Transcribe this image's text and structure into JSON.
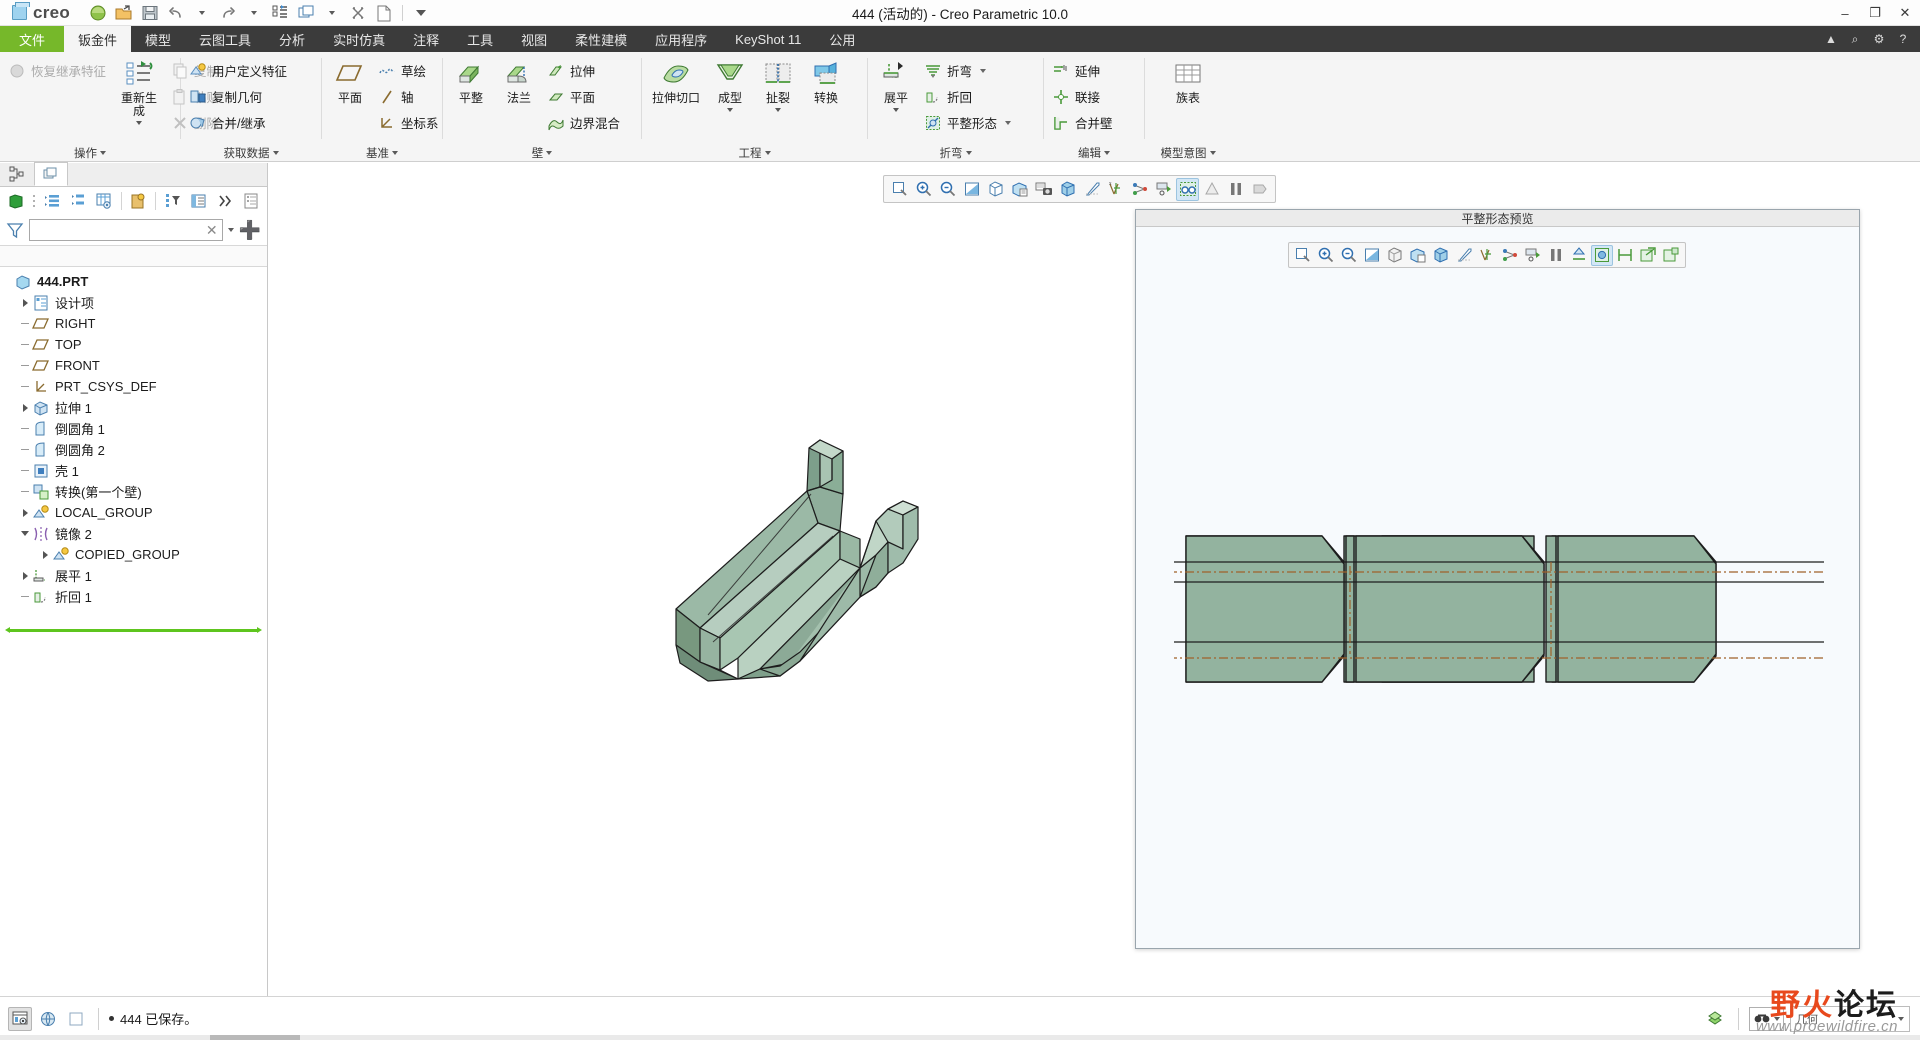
{
  "window": {
    "title": "444 (活动的) - Creo Parametric 10.0",
    "brand": "creo",
    "minimize": "–",
    "maximize": "❐",
    "close": "✕"
  },
  "quick_access": [
    {
      "name": "new-session-icon",
      "label": "新建会话"
    },
    {
      "name": "open-folder-icon",
      "label": "打开"
    },
    {
      "name": "save-icon",
      "label": "保存"
    },
    {
      "name": "undo-icon",
      "label": "撤消"
    },
    {
      "name": "undo-dropdown",
      "label": "撤消列表"
    },
    {
      "name": "redo-icon",
      "label": "重做"
    },
    {
      "name": "redo-dropdown",
      "label": "重做列表"
    },
    {
      "name": "regenerate-icon",
      "label": "重新生成"
    },
    {
      "name": "window-icon",
      "label": "窗口"
    },
    {
      "name": "window-dropdown",
      "label": "窗口列表"
    },
    {
      "name": "close-window-icon",
      "label": "关闭"
    },
    {
      "name": "new-doc-icon",
      "label": "新建"
    },
    {
      "name": "qat-customize",
      "label": "自定义快速访问工具栏"
    }
  ],
  "tabs": [
    {
      "label": "文件",
      "kind": "file"
    },
    {
      "label": "钣金件",
      "kind": "active"
    },
    {
      "label": "模型",
      "kind": "normal"
    },
    {
      "label": "云图工具",
      "kind": "normal"
    },
    {
      "label": "分析",
      "kind": "normal"
    },
    {
      "label": "实时仿真",
      "kind": "normal"
    },
    {
      "label": "注释",
      "kind": "normal"
    },
    {
      "label": "工具",
      "kind": "normal"
    },
    {
      "label": "视图",
      "kind": "normal"
    },
    {
      "label": "柔性建模",
      "kind": "normal"
    },
    {
      "label": "应用程序",
      "kind": "normal"
    },
    {
      "label": "KeyShot 11",
      "kind": "normal"
    },
    {
      "label": "公用",
      "kind": "normal"
    }
  ],
  "tab_right_icons": [
    {
      "name": "collapse-ribbon-icon",
      "glyph": "▲"
    },
    {
      "name": "search-icon",
      "glyph": "⌕"
    },
    {
      "name": "settings-icon",
      "glyph": "⚙"
    },
    {
      "name": "help-icon",
      "glyph": "?"
    }
  ],
  "ribbon": {
    "groups": [
      {
        "label": "操作",
        "items": [
          {
            "name": "restore-inherit-feature",
            "label": "恢复继承特征",
            "icon": "sphere-icon",
            "size": "small",
            "disabled": true
          },
          {
            "name": "regenerate",
            "label": "重新生成",
            "icon": "regenerate-icon",
            "size": "big",
            "dropdown": true
          },
          {
            "name": "copy",
            "label": "复制",
            "icon": "copy-icon",
            "size": "small",
            "disabled": true
          },
          {
            "name": "paste",
            "label": "粘贴",
            "icon": "paste-icon",
            "size": "small",
            "disabled": true,
            "dropdown": true
          },
          {
            "name": "delete",
            "label": "删除",
            "icon": "delete-icon",
            "size": "small",
            "disabled": true,
            "dropdown": true
          }
        ]
      },
      {
        "label": "获取数据",
        "items": [
          {
            "name": "user-defined-feature",
            "label": "用户定义特征",
            "icon": "udf-icon",
            "size": "small"
          },
          {
            "name": "copy-geometry",
            "label": "复制几何",
            "icon": "copy-geom-icon",
            "size": "small"
          },
          {
            "name": "merge-inherit",
            "label": "合并/继承",
            "icon": "merge-icon",
            "size": "small"
          }
        ]
      },
      {
        "label": "基准",
        "items": [
          {
            "name": "datum-plane",
            "label": "平面",
            "icon": "plane-icon",
            "size": "big"
          },
          {
            "name": "sketch",
            "label": "草绘",
            "icon": "sketch-icon",
            "size": "small"
          },
          {
            "name": "datum-axis",
            "label": "轴",
            "icon": "axis-icon",
            "size": "small"
          },
          {
            "name": "coordinate-system",
            "label": "坐标系",
            "icon": "csys-icon",
            "size": "small"
          }
        ]
      },
      {
        "label": "壁",
        "items": [
          {
            "name": "planar-wall",
            "label": "平整",
            "icon": "planar-wall-icon",
            "size": "big"
          },
          {
            "name": "flange-wall",
            "label": "法兰",
            "icon": "flange-icon",
            "size": "big"
          },
          {
            "name": "extrude",
            "label": "拉伸",
            "icon": "extrude-icon",
            "size": "small"
          },
          {
            "name": "flat-surface",
            "label": "平面",
            "icon": "flat-surface-icon",
            "size": "small"
          },
          {
            "name": "boundary-blend",
            "label": "边界混合",
            "icon": "boundary-blend-icon",
            "size": "small"
          }
        ]
      },
      {
        "label": "工程",
        "items": [
          {
            "name": "extruded-cut",
            "label": "拉伸切口",
            "icon": "extruded-cut-icon",
            "size": "big"
          },
          {
            "name": "form",
            "label": "成型",
            "icon": "form-icon",
            "size": "big",
            "dropdown": true
          },
          {
            "name": "rip",
            "label": "扯裂",
            "icon": "rip-icon",
            "size": "big",
            "dropdown": true
          },
          {
            "name": "convert",
            "label": "转换",
            "icon": "convert-icon",
            "size": "big"
          }
        ]
      },
      {
        "label": "折弯",
        "items": [
          {
            "name": "unbend",
            "label": "展平",
            "icon": "unbend-icon",
            "size": "big",
            "dropdown": true
          },
          {
            "name": "bend",
            "label": "折弯",
            "icon": "bend-icon",
            "size": "small",
            "dropdown": true
          },
          {
            "name": "bend-back",
            "label": "折回",
            "icon": "bend-back-icon",
            "size": "small"
          },
          {
            "name": "flat-state",
            "label": "平整形态",
            "icon": "flat-state-icon",
            "size": "small",
            "dropdown": true
          }
        ]
      },
      {
        "label": "编辑",
        "items": [
          {
            "name": "extend",
            "label": "延伸",
            "icon": "extend-icon",
            "size": "small"
          },
          {
            "name": "merge",
            "label": "联接",
            "icon": "join-icon",
            "size": "small"
          },
          {
            "name": "merge-walls",
            "label": "合并壁",
            "icon": "merge-walls-icon",
            "size": "small"
          }
        ]
      },
      {
        "label": "模型意图",
        "items": [
          {
            "name": "family-table",
            "label": "族表",
            "icon": "family-table-icon",
            "size": "big"
          }
        ]
      }
    ]
  },
  "navigator": {
    "tabs": [
      {
        "name": "model-tree-tab",
        "icon": "model-tree-icon"
      },
      {
        "name": "layer-tree-tab",
        "icon": "layers-icon"
      }
    ],
    "toolbar": [
      {
        "name": "show-display-icon",
        "glyph": "box"
      },
      {
        "name": "tree-columns-icon",
        "glyph": "list"
      },
      {
        "name": "tree-filters-icon",
        "glyph": "filters"
      },
      {
        "name": "tree-settings-icon",
        "glyph": "settings"
      },
      {
        "name": "search-model-icon",
        "glyph": "search"
      },
      {
        "name": "filter-icon",
        "glyph": "funnel"
      },
      {
        "name": "display-style-icon",
        "glyph": "display"
      },
      {
        "name": "more-icon",
        "glyph": "chevrons"
      },
      {
        "name": "detail-icon",
        "glyph": "detail"
      }
    ],
    "filter": {
      "value": "",
      "placeholder": ""
    },
    "tree": [
      {
        "label": "444.PRT",
        "icon": "part-icon",
        "indent": 0,
        "twist": "none"
      },
      {
        "label": "设计项",
        "icon": "design-items-icon",
        "indent": 1,
        "twist": "right"
      },
      {
        "label": "RIGHT",
        "icon": "datum-plane-icon",
        "indent": 1,
        "twist": "dash"
      },
      {
        "label": "TOP",
        "icon": "datum-plane-icon",
        "indent": 1,
        "twist": "dash"
      },
      {
        "label": "FRONT",
        "icon": "datum-plane-icon",
        "indent": 1,
        "twist": "dash"
      },
      {
        "label": "PRT_CSYS_DEF",
        "icon": "csys-icon",
        "indent": 1,
        "twist": "dash"
      },
      {
        "label": "拉伸 1",
        "icon": "extrude-feat-icon",
        "indent": 1,
        "twist": "right"
      },
      {
        "label": "倒圆角 1",
        "icon": "round-icon",
        "indent": 1,
        "twist": "dash"
      },
      {
        "label": "倒圆角 2",
        "icon": "round-icon",
        "indent": 1,
        "twist": "dash"
      },
      {
        "label": "壳 1",
        "icon": "shell-icon",
        "indent": 1,
        "twist": "dash"
      },
      {
        "label": "转换(第一个壁)",
        "icon": "convert-feat-icon",
        "indent": 1,
        "twist": "dash"
      },
      {
        "label": "LOCAL_GROUP",
        "icon": "group-icon",
        "indent": 1,
        "twist": "right"
      },
      {
        "label": "镜像 2",
        "icon": "mirror-icon",
        "indent": 1,
        "twist": "down"
      },
      {
        "label": "COPIED_GROUP",
        "icon": "group-icon",
        "indent": 2,
        "twist": "right"
      },
      {
        "label": "展平 1",
        "icon": "unbend-feat-icon",
        "indent": 1,
        "twist": "right"
      },
      {
        "label": "折回 1",
        "icon": "bendback-feat-icon",
        "indent": 1,
        "twist": "dash"
      }
    ]
  },
  "graphics_toolbar": [
    {
      "name": "refit-icon",
      "active": false
    },
    {
      "name": "zoom-in-icon",
      "active": false
    },
    {
      "name": "zoom-out-icon",
      "active": false
    },
    {
      "name": "repaint-icon",
      "active": false
    },
    {
      "name": "saved-orientations-icon",
      "active": false
    },
    {
      "name": "view-manager-icon",
      "active": false
    },
    {
      "name": "capture-image-icon",
      "active": false
    },
    {
      "name": "display-style-icon",
      "active": false
    },
    {
      "name": "perspective-icon",
      "active": false
    },
    {
      "name": "datum-display-icon",
      "active": false
    },
    {
      "name": "annotation-display-icon",
      "active": false
    },
    {
      "name": "spin-center-icon",
      "active": false
    },
    {
      "name": "visibility-icon",
      "active": true
    },
    {
      "name": "appearance-icon",
      "active": false
    },
    {
      "name": "pause-icon",
      "active": false
    },
    {
      "name": "stop-icon",
      "active": false
    }
  ],
  "preview_window": {
    "title": "平整形态预览",
    "toolbar": [
      {
        "name": "refit-icon",
        "active": false
      },
      {
        "name": "zoom-in-icon",
        "active": false
      },
      {
        "name": "zoom-out-icon",
        "active": false
      },
      {
        "name": "repaint-icon",
        "active": false
      },
      {
        "name": "saved-orientations-icon",
        "active": false
      },
      {
        "name": "view-manager-icon",
        "active": false
      },
      {
        "name": "display-style-icon",
        "active": false
      },
      {
        "name": "perspective-icon",
        "active": false
      },
      {
        "name": "datum-display-icon",
        "active": false
      },
      {
        "name": "annotation-display-icon",
        "active": false
      },
      {
        "name": "spin-center-icon",
        "active": false
      },
      {
        "name": "pause-icon",
        "active": false
      },
      {
        "name": "orient-icon",
        "active": false
      },
      {
        "name": "flat-pattern-icon",
        "active": true
      },
      {
        "name": "dimension-icon",
        "active": false
      },
      {
        "name": "export-icon",
        "active": false
      },
      {
        "name": "save-flat-icon",
        "active": false
      }
    ]
  },
  "status_bar": {
    "left_icons": [
      {
        "name": "display-info-icon",
        "active": true
      },
      {
        "name": "globe-icon",
        "active": false
      },
      {
        "name": "blank-icon",
        "active": false
      }
    ],
    "message": "444 已保存。",
    "right_icons": [
      {
        "name": "regenerate-status-icon"
      },
      {
        "name": "find-icon"
      },
      {
        "name": "find-dropdown-icon"
      }
    ],
    "selection_filter": "几何",
    "watermark_cn": "野火论坛",
    "watermark_url": "www.proewildfire.cn"
  },
  "colors": {
    "file_tab_green": "#76b82a",
    "ribbon_bg": "#f5f5f5",
    "tabstrip_bg": "#3b3b3b",
    "model_face": "#93b39f",
    "model_edge": "#1d1d1d",
    "bend_line": "#a0622a",
    "tree_green_bar": "#5ec51e",
    "preview_bg": "#f7fafd"
  }
}
